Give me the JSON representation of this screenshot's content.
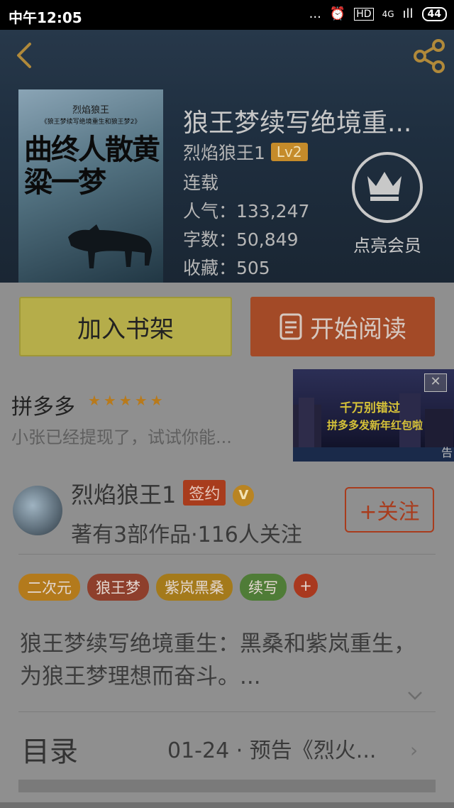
{
  "status_bar": {
    "time": "中午12:05",
    "indicators": [
      "...",
      "⏰",
      "HD",
      "4G",
      "ıll"
    ],
    "battery": "44"
  },
  "header": {
    "back_icon": "back-chevron-icon",
    "share_icon": "share-icon"
  },
  "book": {
    "cover": {
      "author_line": "烈焰狼王",
      "subtitle_line": "《狼王梦续写绝境重生和狼王梦2》",
      "title_art": "曲终人散黄粱一梦"
    },
    "title": "狼王梦续写绝境重...",
    "author": "烈焰狼王1",
    "level": "Lv2",
    "status": "连载",
    "popularity": "人气：133,247",
    "word_count": "字数：50,849",
    "favorites": "收藏：505"
  },
  "vip": {
    "label": "点亮会员",
    "icon": "crown-icon"
  },
  "actions": {
    "add_shelf": "加入书架",
    "start_reading": "开始阅读"
  },
  "ad": {
    "sponsor": "拼多多",
    "stars": "★★★★★",
    "desc": "小张已经提现了，试试你能...",
    "image_line1": "千万别错过",
    "image_line2": "拼多多发新年红包啦",
    "tag": "告",
    "close": "✕"
  },
  "author_info": {
    "name": "烈焰狼王1",
    "signed": "签约",
    "verified_badge": "V",
    "stats": "著有3部作品·116人关注",
    "follow": "+关注"
  },
  "tags": [
    "二次元",
    "狼王梦",
    "紫岚黑桑",
    "续写"
  ],
  "tag_add": "+",
  "summary": "狼王梦续写绝境重生：黑桑和紫岚重生，为狼王梦理想而奋斗。...",
  "toc": {
    "label": "目录",
    "latest": "01-24 · 预告《烈火...",
    "chevron": "›"
  },
  "colors": {
    "shelf_button": "#b5ad4a",
    "read_button": "#a34a27",
    "accent_red": "#a83c1d"
  }
}
